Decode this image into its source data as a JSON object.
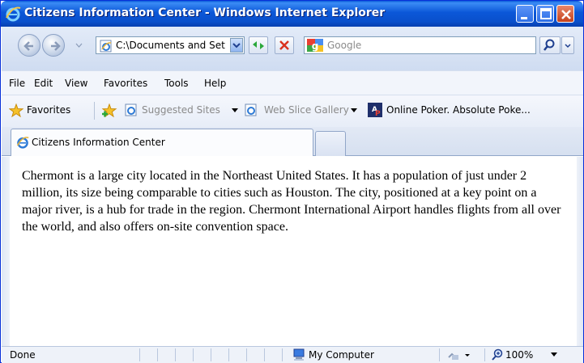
{
  "window": {
    "title": "Citizens Information Center - Windows Internet Explorer"
  },
  "address": {
    "value": "C:\\Documents and Set"
  },
  "search": {
    "placeholder": "Google"
  },
  "menu": {
    "items": [
      "File",
      "Edit",
      "View",
      "Favorites",
      "Tools",
      "Help"
    ]
  },
  "favorites_bar": {
    "favorites_label": "Favorites",
    "suggested_sites": "Suggested Sites",
    "web_slice_gallery": "Web Slice Gallery",
    "link": "Online Poker. Absolute Poke..."
  },
  "tabs": {
    "active_label": "Citizens Information Center"
  },
  "content": {
    "paragraph": "Chermont is a large city located in the Northeast United States. It has a population of just under 2 million, its size being comparable to cities such as Houston. The city, positioned at a key point on a major river, is a hub for trade in the region. Chermont International Airport handles flights from all over the world, and also offers on-site convention space."
  },
  "status": {
    "text": "Done",
    "zone": "My Computer",
    "zoom": "100%"
  },
  "colors": {
    "titlebar": "#0a57d8",
    "close_button": "#c5411c",
    "chrome": "#dbe4f3"
  },
  "icons": [
    "ie-logo-icon",
    "minimize-icon",
    "maximize-icon",
    "close-icon",
    "back-arrow-icon",
    "forward-arrow-icon",
    "refresh-icon",
    "stop-icon",
    "google-logo-icon",
    "search-magnifier-icon",
    "favorites-star-icon",
    "add-favorite-icon",
    "computer-icon",
    "zoom-icon"
  ]
}
